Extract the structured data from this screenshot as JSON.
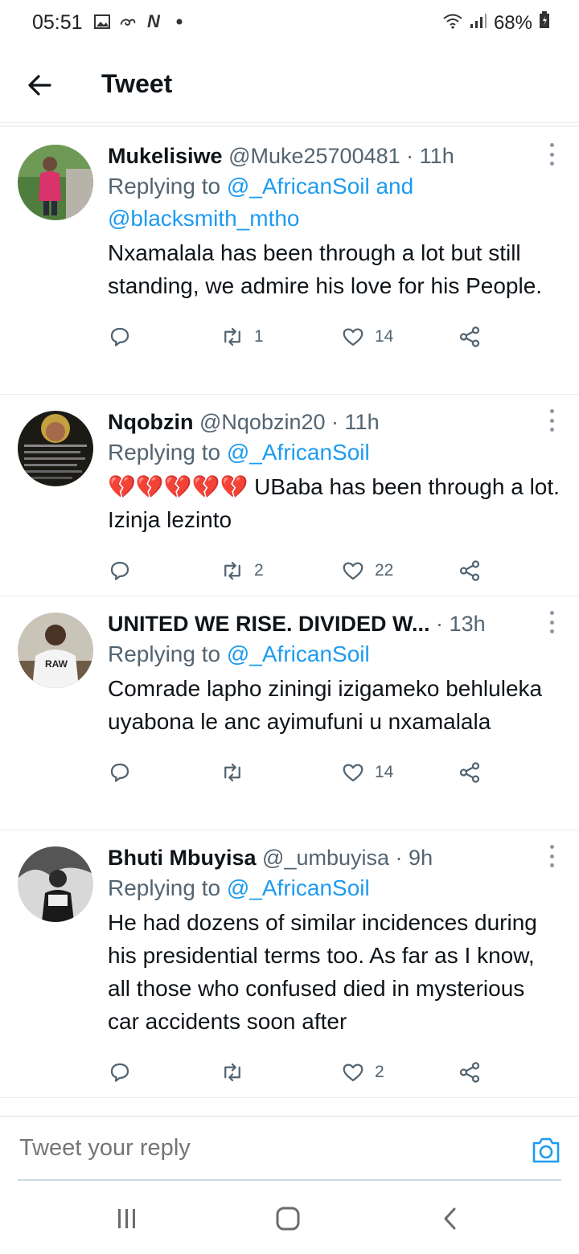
{
  "status_bar": {
    "time": "05:51",
    "left_icons": [
      "gallery-icon",
      "link-icon",
      "n-icon",
      "dot-icon"
    ],
    "battery": "68%"
  },
  "header": {
    "title": "Tweet"
  },
  "tweets": [
    {
      "name": "Mukelisiwe",
      "handle": "@Muke25700481",
      "time": "11h",
      "replying_prefix": "Replying to ",
      "replying_mentions": "@_AfricanSoil and @blacksmith_mtho",
      "text": "Nxamalala has been through a lot but still standing, we admire his love for his People.",
      "retweets": "1",
      "likes": "14"
    },
    {
      "name": "Nqobzin",
      "handle": "@Nqobzin20",
      "time": "11h",
      "replying_prefix": "Replying to ",
      "replying_mentions": "@_AfricanSoil",
      "text": "💔💔💔💔💔 UBaba has been through a lot. Izinja lezinto",
      "retweets": "2",
      "likes": "22"
    },
    {
      "name": "UNITED WE RISE. DIVIDED W...",
      "handle": "",
      "time": "13h",
      "replying_prefix": "Replying to ",
      "replying_mentions": "@_AfricanSoil",
      "text": "Comrade lapho ziningi izigameko behluleka uyabona le anc ayimufuni u nxamalala",
      "retweets": "",
      "likes": "14"
    },
    {
      "name": "Bhuti Mbuyisa",
      "handle": "@_umbuyisa",
      "time": "9h",
      "replying_prefix": "Replying to ",
      "replying_mentions": "@_AfricanSoil",
      "text": "He had dozens of similar incidences during his presidential terms too. As far as I know, all those who confused died in mysterious car accidents soon after",
      "retweets": "",
      "likes": "2"
    }
  ],
  "reply_bar": {
    "placeholder": "Tweet your reply"
  },
  "nav": {
    "icons": [
      "recent-apps-icon",
      "home-icon",
      "back-icon"
    ]
  },
  "colors": {
    "accent": "#1d9bf0",
    "secondary_text": "#536471",
    "primary_text": "#0f1419"
  }
}
